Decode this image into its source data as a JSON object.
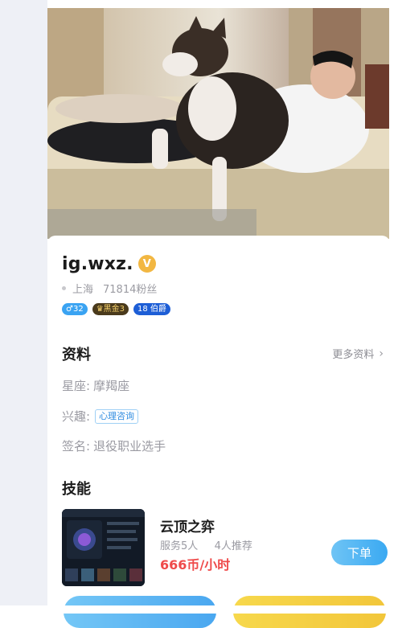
{
  "profile": {
    "username": "ig.wxz.",
    "verify_mark": "V",
    "location": "上海",
    "followers": "71814粉丝",
    "badges": {
      "gender_age": "♂32",
      "rank": "♛黑金3",
      "noble": "18 伯爵"
    }
  },
  "info": {
    "section_title": "资料",
    "more_label": "更多资料",
    "more_icon": "chevron-right",
    "constellation_label": "星座:",
    "constellation_value": "摩羯座",
    "interest_label": "兴趣:",
    "interest_tag": "心理咨询",
    "signature_label": "签名:",
    "signature_value": "退役职业选手"
  },
  "skills": {
    "section_title": "技能",
    "items": [
      {
        "game": "云顶之弈",
        "service_count": "服务5人",
        "recommend_count": "4人推荐",
        "price": "666币/小时",
        "order_label": "下单"
      }
    ]
  },
  "colors": {
    "accent_blue": "#3aa9f2",
    "price_red": "#ef4a4a",
    "verify_gold": "#f2b742",
    "cta_yellow": "#f2c63a"
  }
}
